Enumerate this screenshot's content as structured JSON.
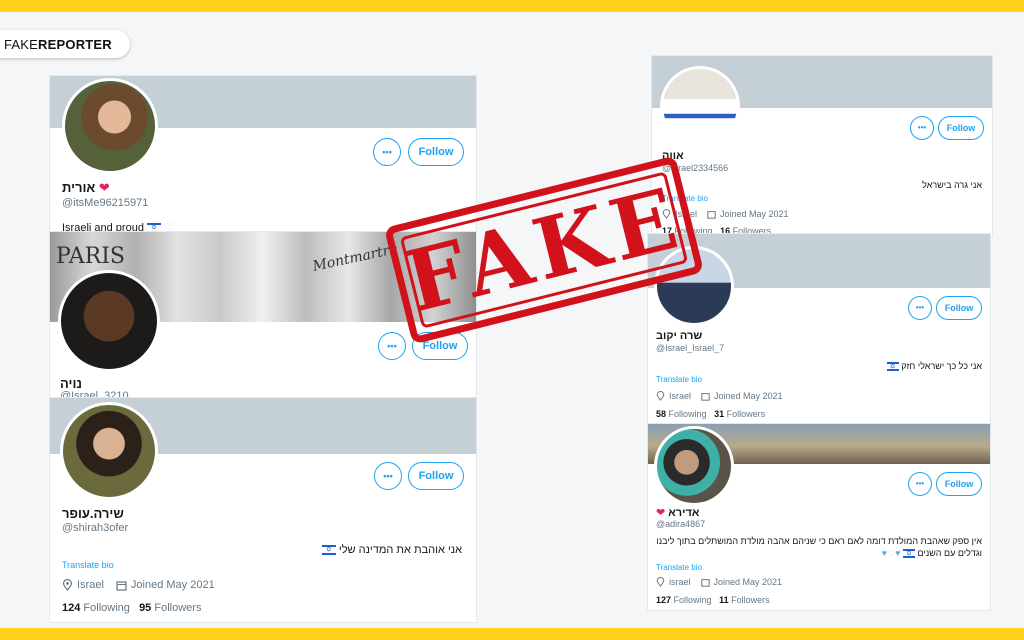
{
  "brand": {
    "part1": "FAKE",
    "part2": "REPORTER"
  },
  "stamp": {
    "text": "FAKE"
  },
  "colors": {
    "accent": "#1da1f2",
    "stamp": "#d1121b",
    "stripe": "#ffd21f"
  },
  "cards": {
    "c1": {
      "name": "אורית",
      "handle": "@itsMe96215971",
      "bio": "Israeli and proud",
      "follow": "Follow",
      "more": "•••"
    },
    "c2": {
      "name": "נויה",
      "handle": "@Israel_3210",
      "follow": "Follow",
      "more": "•••",
      "banner_text_1": "PARIS",
      "banner_text_2": "Montmartre"
    },
    "c3": {
      "name": "שירה.עופר",
      "handle": "@shirah3ofer",
      "bio": "אני אוהבת את המדינה שלי",
      "translate": "Translate bio",
      "location": "Israel",
      "joined": "Joined May 2021",
      "following_count": "124",
      "following_label": "Following",
      "followers_count": "95",
      "followers_label": "Followers",
      "follow": "Follow",
      "more": "•••"
    },
    "c4": {
      "name": "אווה",
      "handle": "@Israel2334566",
      "bio": "אני גרה בישראל",
      "translate": "Translate bio",
      "location": "Israel",
      "joined": "Joined May 2021",
      "following_count": "17",
      "following_label": "Following",
      "followers_count": "16",
      "followers_label": "Followers",
      "follow": "Follow",
      "more": "•••"
    },
    "c5": {
      "name": "שרה יקוב",
      "handle": "@Israel_Israel_7",
      "bio": "אני כל כך ישראלי חזק",
      "translate": "Translate bio",
      "location": "Israel",
      "joined": "Joined May 2021",
      "following_count": "58",
      "following_label": "Following",
      "followers_count": "31",
      "followers_label": "Followers",
      "follow": "Follow",
      "more": "•••"
    },
    "c6": {
      "name": "אדירא",
      "handle": "@adira4867",
      "bio1": "אין ספק שאהבת המולדת דומה לאם ראם כי שניהם אהבה מולדת המושתלים בתוך ליבנו",
      "bio2": "וגדלים עם השנים",
      "translate": "Translate bio",
      "location": "israel",
      "joined": "Joined May 2021",
      "following_count": "127",
      "following_label": "Following",
      "followers_count": "11",
      "followers_label": "Followers",
      "follow": "Follow",
      "more": "•••"
    }
  }
}
